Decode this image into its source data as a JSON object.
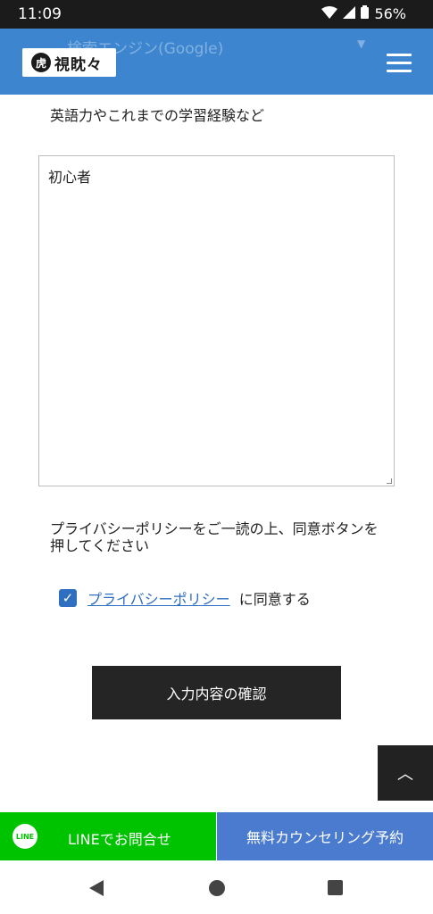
{
  "status": {
    "time": "11:09",
    "battery": "56%"
  },
  "header": {
    "ghost_text": "検索エンジン(Google)",
    "logo_mark": "虎",
    "logo_text": "視眈々"
  },
  "form": {
    "experience_label": "英語力やこれまでの学習経験など",
    "experience_value": "初心者",
    "privacy_notice": "プライバシーポリシーをご一読の上、同意ボタンを押してください",
    "privacy_link": "プライバシーポリシー",
    "agree_suffix": "に同意する",
    "agree_checked": true,
    "confirm_label": "入力内容の確認"
  },
  "bottom_bar": {
    "line_icon_text": "LINE",
    "line_label": "LINEでお問合せ",
    "counsel_label": "無料カウンセリング予約"
  },
  "colors": {
    "header": "#3d86cf",
    "line_green": "#00c300",
    "counsel_blue": "#4a7bcf",
    "checkbox": "#2f6fbf"
  }
}
